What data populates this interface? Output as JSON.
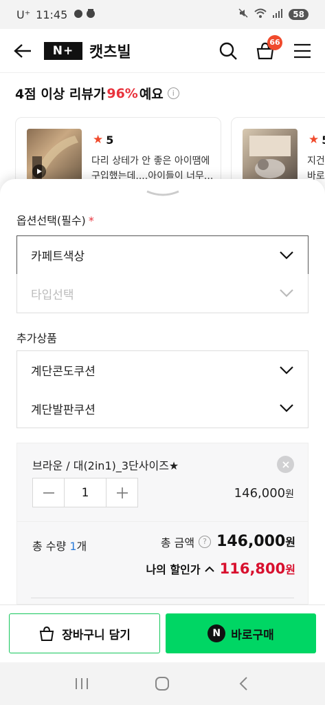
{
  "status_bar": {
    "carrier": "U⁺",
    "time": "11:45",
    "battery": "58"
  },
  "header": {
    "logo": "N+",
    "store_name": "캣츠빌",
    "cart_count": "66"
  },
  "reviews": {
    "title_prefix": "4점 이상 리뷰가 ",
    "title_percent": "96%",
    "title_suffix": "예요",
    "cards": [
      {
        "rating": "5",
        "text": "다리 상테가 안 좋은 아이땜에 구입했는데....아이들이 너무..."
      },
      {
        "rating": "5",
        "text": "지건\n바로"
      }
    ]
  },
  "options": {
    "label": "옵션선택(필수)",
    "required_mark": "*",
    "select1": "카페트색상",
    "select2": "타입선택"
  },
  "additional": {
    "label": "추가상품",
    "select1": "계단콘도쿠션",
    "select2": "계단발판쿠션"
  },
  "selected_item": {
    "name": "브라운 / 대(2in1)_3단사이즈★",
    "quantity": "1",
    "price": "146,000",
    "currency": "원"
  },
  "summary": {
    "total_qty_label": "총 수량 ",
    "total_qty_num": "1",
    "total_qty_unit": "개",
    "total_amount_label": "총 금액",
    "total_amount": "146,000",
    "currency": "원",
    "discount_label": "나의 할인가",
    "discount_price": "116,800"
  },
  "actions": {
    "cart_label": "장바구니 담기",
    "buy_label": "바로구매",
    "npay_letter": "N"
  },
  "colors": {
    "accent_red": "#e8323c",
    "naver_green": "#00d664",
    "discount_red": "#d8102e"
  }
}
